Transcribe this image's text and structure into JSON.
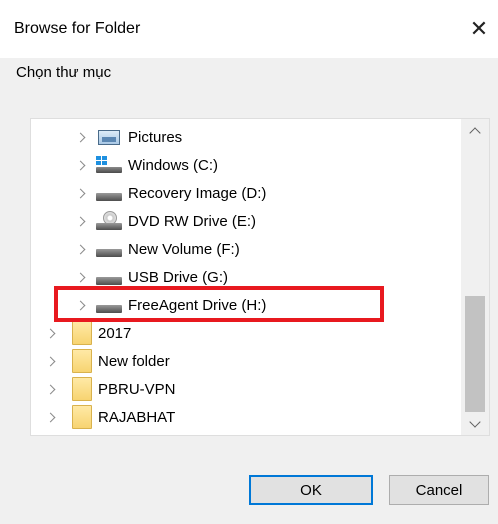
{
  "window": {
    "title": "Browse for Folder",
    "close_glyph": "✕"
  },
  "instruction": "Chọn thư mục",
  "tree": {
    "items": [
      {
        "label": "Pictures",
        "icon": "pictures-icon"
      },
      {
        "label": "Windows (C:)",
        "icon": "windows-drive-icon"
      },
      {
        "label": "Recovery Image (D:)",
        "icon": "drive-icon"
      },
      {
        "label": "DVD RW Drive (E:)",
        "icon": "dvd-drive-icon"
      },
      {
        "label": "New Volume (F:)",
        "icon": "drive-icon"
      },
      {
        "label": "USB Drive (G:)",
        "icon": "drive-icon"
      },
      {
        "label": "FreeAgent Drive (H:)",
        "icon": "drive-icon"
      },
      {
        "label": "2017",
        "icon": "folder-icon"
      },
      {
        "label": "New folder",
        "icon": "folder-icon"
      },
      {
        "label": "PBRU-VPN",
        "icon": "folder-icon"
      },
      {
        "label": "RAJABHAT",
        "icon": "folder-icon"
      }
    ]
  },
  "buttons": {
    "ok": "OK",
    "cancel": "Cancel"
  },
  "colors": {
    "highlight": "#e8191f",
    "default_button_border": "#0078d7"
  }
}
